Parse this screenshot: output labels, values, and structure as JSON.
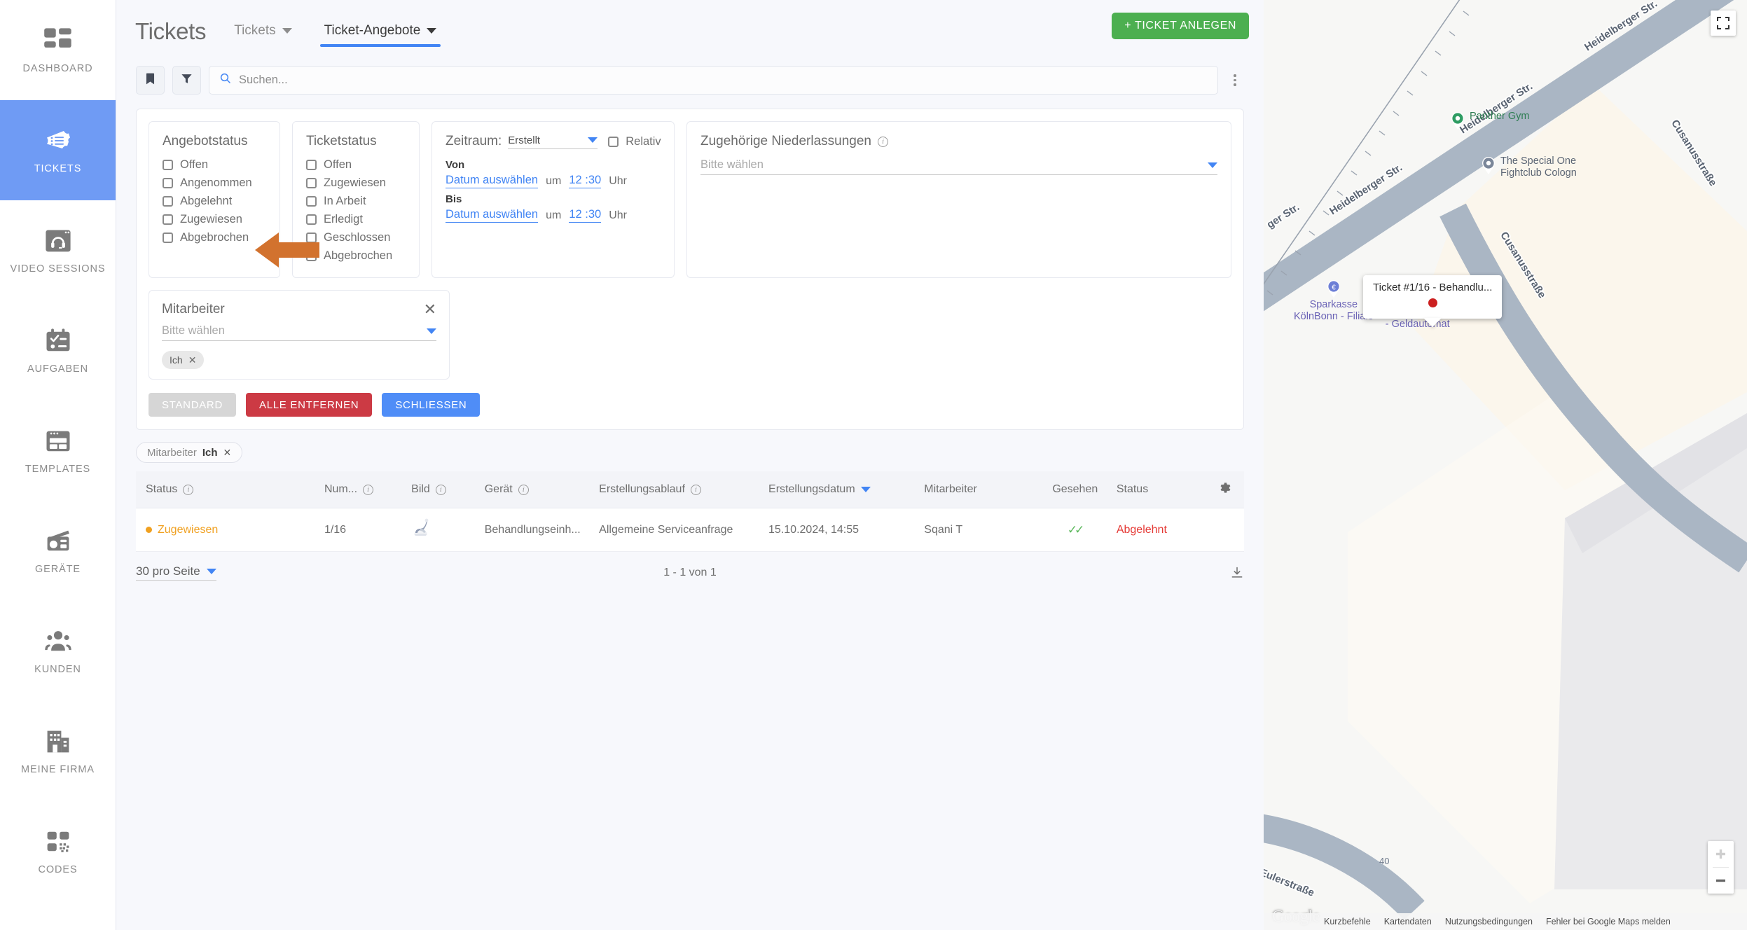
{
  "sidebar": {
    "items": [
      {
        "label": "DASHBOARD",
        "icon": "dashboard-icon",
        "active": false
      },
      {
        "label": "TICKETS",
        "icon": "tickets-icon",
        "active": true
      },
      {
        "label": "VIDEO SESSIONS",
        "icon": "video-session-icon",
        "active": false
      },
      {
        "label": "AUFGABEN",
        "icon": "tasks-icon",
        "active": false
      },
      {
        "label": "TEMPLATES",
        "icon": "templates-icon",
        "active": false
      },
      {
        "label": "GERÄTE",
        "icon": "devices-icon",
        "active": false
      },
      {
        "label": "KUNDEN",
        "icon": "customers-icon",
        "active": false
      },
      {
        "label": "MEINE FIRMA",
        "icon": "company-icon",
        "active": false
      },
      {
        "label": "CODES",
        "icon": "codes-icon",
        "active": false
      }
    ]
  },
  "header": {
    "title": "Tickets",
    "tabs": [
      {
        "label": "Tickets",
        "active": false
      },
      {
        "label": "Ticket-Angebote",
        "active": true
      }
    ],
    "create_button": "+ TICKET ANLEGEN"
  },
  "toolbar": {
    "bookmark_icon": "bookmark-icon",
    "filter_icon": "funnel-icon",
    "search_placeholder": "Suchen...",
    "search_value": "",
    "more_icon": "kebab-menu-icon"
  },
  "filters": {
    "angebotstatus": {
      "title": "Angebotstatus",
      "options": [
        "Offen",
        "Angenommen",
        "Abgelehnt",
        "Zugewiesen",
        "Abgebrochen"
      ]
    },
    "ticketstatus": {
      "title": "Ticketstatus",
      "options": [
        "Offen",
        "Zugewiesen",
        "In Arbeit",
        "Erledigt",
        "Geschlossen",
        "Abgebrochen"
      ]
    },
    "zeitraum": {
      "label": "Zeitraum:",
      "selected": "Erstellt",
      "relativ_label": "Relativ",
      "von_label": "Von",
      "bis_label": "Bis",
      "date_placeholder": "Datum auswählen",
      "um_label": "um",
      "time_value": "12 :30",
      "uhr_label": "Uhr"
    },
    "niederlassungen": {
      "title": "Zugehörige Niederlassungen",
      "placeholder": "Bitte wählen",
      "info_icon": "info-icon"
    },
    "mitarbeiter": {
      "title": "Mitarbeiter",
      "placeholder": "Bitte wählen",
      "close_icon": "close-icon",
      "chips": [
        {
          "label": "Ich",
          "remove_icon": "remove-icon"
        }
      ]
    },
    "actions": {
      "standard": "STANDARD",
      "remove_all": "ALLE ENTFERNEN",
      "close": "SCHLIESSEN"
    }
  },
  "applied_filters": [
    {
      "name": "Mitarbeiter",
      "value": "Ich",
      "remove_icon": "remove-icon"
    }
  ],
  "table": {
    "columns": [
      {
        "label": "Status",
        "info": true
      },
      {
        "label": "Num...",
        "info": true
      },
      {
        "label": "Bild",
        "info": true
      },
      {
        "label": "Gerät",
        "info": true
      },
      {
        "label": "Erstellungsablauf",
        "info": true
      },
      {
        "label": "Erstellungsdatum",
        "info": false,
        "sorted": "desc"
      },
      {
        "label": "Mitarbeiter",
        "info": false
      },
      {
        "label": "Gesehen",
        "info": false
      },
      {
        "label": "Status",
        "info": false
      }
    ],
    "settings_icon": "gear-icon",
    "rows": [
      {
        "status": "Zugewiesen",
        "nummer": "1/16",
        "bild": "device-thumbnail",
        "geraet": "Behandlungseinh...",
        "ablauf": "Allgemeine Serviceanfrage",
        "datum": "15.10.2024, 14:55",
        "mitarbeiter": "Sqani T",
        "gesehen": "✓✓",
        "angebot_status": "Abgelehnt"
      }
    ],
    "footer": {
      "per_page": "30 pro Seite",
      "range": "1 - 1 von 1",
      "download_icon": "download-icon"
    }
  },
  "map": {
    "fullscreen_icon": "fullscreen-icon",
    "zoom_in_icon": "plus-icon",
    "zoom_out_icon": "minus-icon",
    "google_logo": "Google",
    "streets": [
      "ger Str.",
      "Heidelberger Str.",
      "Heidelberger Str.",
      "Heidelberger Str.",
      "Cusanusstraße",
      "Cusanusstraße",
      "Eulerstraße"
    ],
    "house_number": "40",
    "pois": [
      {
        "name": "Panther Gym",
        "color": "green"
      },
      {
        "name": "The Special One\nFightclub Cologn",
        "color": "grey"
      },
      {
        "name": "Sparkasse\nKölnBonn - Filiale",
        "color": "purple"
      },
      {
        "name": "Sparkasse KölnBonn\n- Geldautomat",
        "color": "purple"
      }
    ],
    "tooltip": {
      "text": "Ticket #1/16 - Behandlu...",
      "marker_color": "#cc2020"
    },
    "footer_links": [
      "Kurzbefehle",
      "Kartendaten",
      "Nutzungsbedingungen",
      "Fehler bei Google Maps melden"
    ]
  },
  "annotation": {
    "arrow_icon": "pointer-arrow-icon",
    "color": "#d2722e"
  },
  "colors": {
    "accent": "#4285f4",
    "sidebar_active": "#6f9bf4",
    "create_button": "#4caf50",
    "danger": "#cc3a44",
    "status_assigned": "#f0a020",
    "status_rejected": "#e53935"
  }
}
